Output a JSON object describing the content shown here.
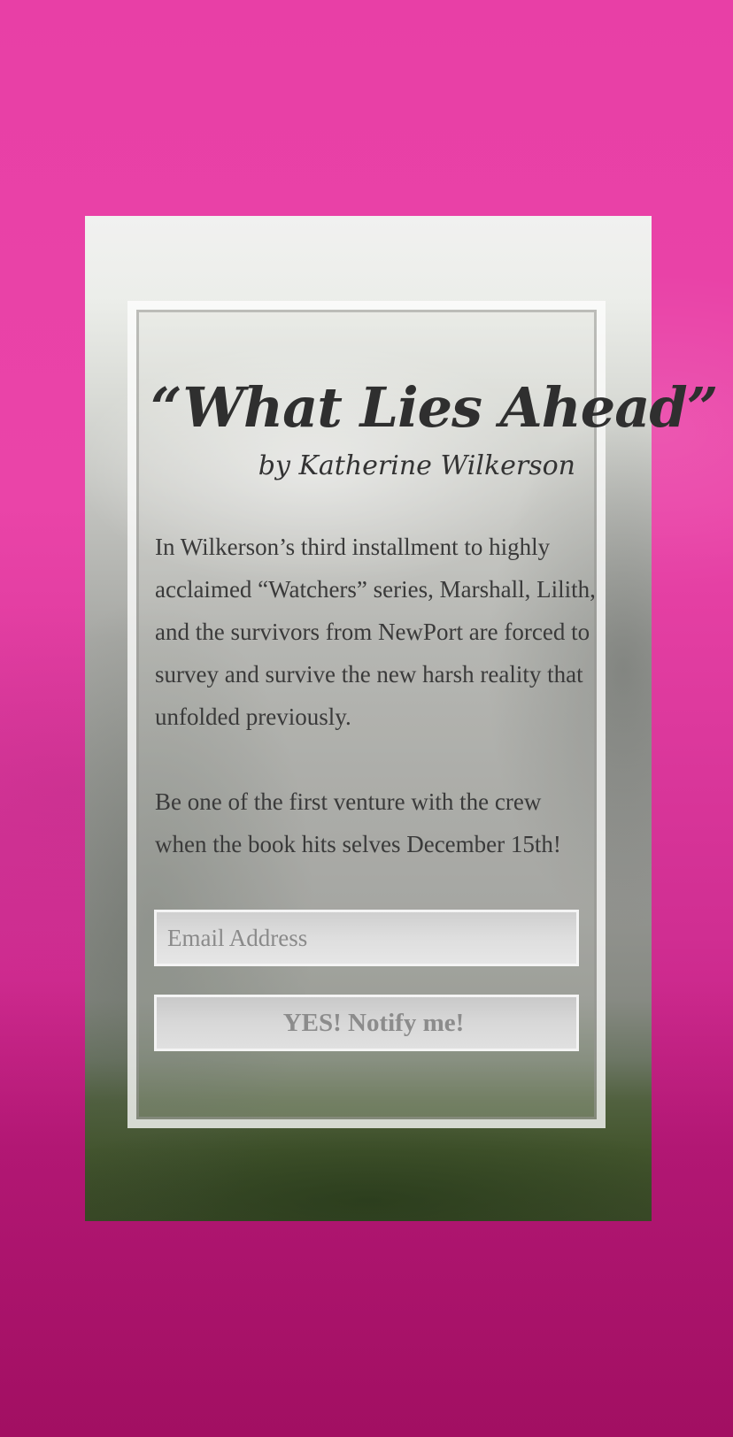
{
  "book": {
    "title": "“What Lies Ahead”",
    "byline": "by Katherine Wilkerson"
  },
  "description": {
    "paragraph_1": "In Wilkerson’s third installment to highly acclaimed “Watchers” series, Marshall, Lilith, and the survivors from NewPort are forced to survey and survive the new harsh reality that unfolded previously.",
    "paragraph_2": "Be one of the first venture with the crew when the book hits selves December 15th!"
  },
  "signup": {
    "email_placeholder": "Email Address",
    "email_value": "",
    "submit_label": "YES! Notify me!"
  },
  "colors": {
    "background_pink": "#e83fa6",
    "text_dark": "#2f2f2f",
    "button_text": "#8c8c8c"
  }
}
